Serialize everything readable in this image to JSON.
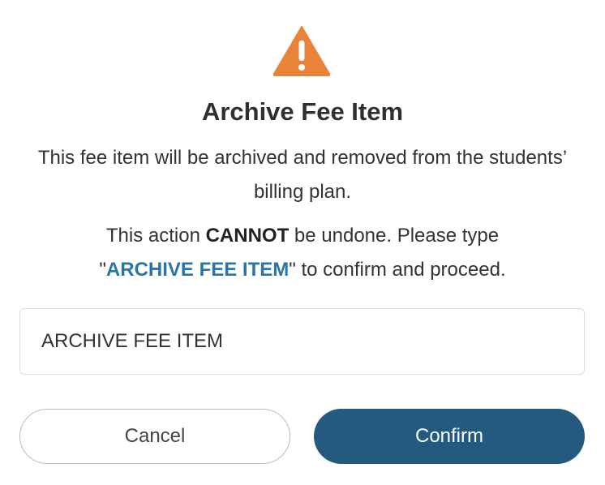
{
  "dialog": {
    "icon": "warning-triangle-icon",
    "icon_color": "#e8843a",
    "title": "Archive Fee Item",
    "description": "This fee item will be archived and removed from the students’ billing plan.",
    "warning_prefix": "This action ",
    "warning_emphasis": "CANNOT",
    "warning_middle": " be undone. Please type ",
    "quote_open": "\"",
    "keyword": "ARCHIVE FEE ITEM",
    "quote_close": "\"",
    "warning_suffix": " to confirm and proceed.",
    "input_value": "ARCHIVE FEE ITEM",
    "cancel_label": "Cancel",
    "confirm_label": "Confirm"
  },
  "colors": {
    "accent": "#2a75a8",
    "confirm_button": "#235a7d",
    "warning": "#e8843a"
  }
}
